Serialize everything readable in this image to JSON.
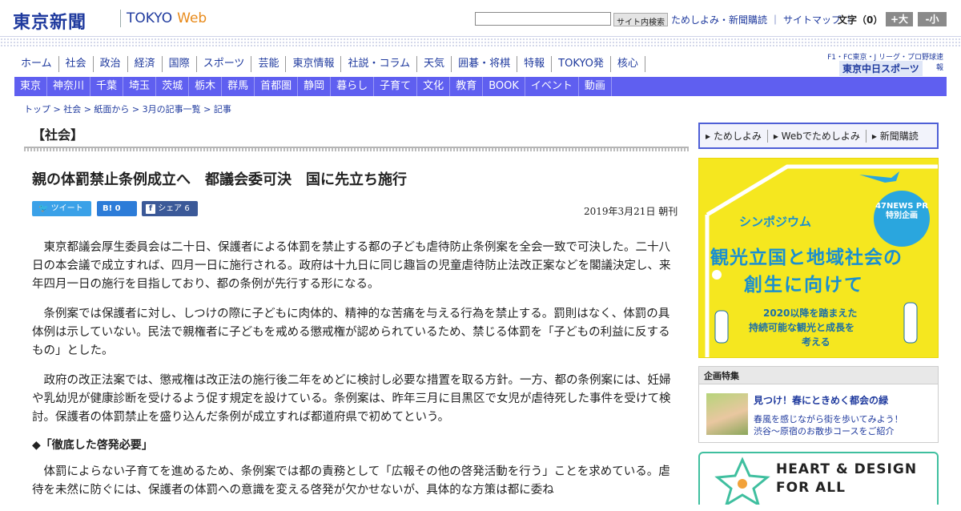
{
  "header": {
    "logo": "東京新聞",
    "logo_tokyo": "TOKYO",
    "logo_web": "Web",
    "search_button": "サイト内検索",
    "links": [
      "ためしよみ・新聞購読",
      "｜",
      "サイトマップ",
      "｜"
    ],
    "font_size_label": "文字（0）",
    "font_bigger": "+大",
    "font_smaller": "-小"
  },
  "nav_primary": [
    "ホーム",
    "社会",
    "政治",
    "経済",
    "国際",
    "スポーツ",
    "芸能",
    "東京情報",
    "社説・コラム",
    "天気",
    "囲碁・将棋",
    "特報",
    "TOKYO発",
    "核心"
  ],
  "chunichi": {
    "caption": "F1・FC東京・J リーグ・プロ野球速報",
    "brand": "東京中日スポーツ"
  },
  "nav_local": [
    "東京",
    "神奈川",
    "千葉",
    "埼玉",
    "茨城",
    "栃木",
    "群馬",
    "首都圏",
    "静岡",
    "暮らし",
    "子育て",
    "文化",
    "教育",
    "BOOK",
    "イベント",
    "動画"
  ],
  "breadcrumb": "トップ > 社会 > 紙面から > 3月の記事一覧 > 記事",
  "article": {
    "category": "【社会】",
    "headline": "親の体罰禁止条例成立へ　都議会委可決　国に先立ち施行",
    "share": {
      "tweet": "ツイート",
      "hatena": "B!  0",
      "facebook": "シェア 6"
    },
    "date": "2019年3月21日 朝刊",
    "p1": "東京都議会厚生委員会は二十日、保護者による体罰を禁止する都の子ども虐待防止条例案を全会一致で可決した。二十八日の本会議で成立すれば、四月一日に施行される。政府は十九日に同じ趣旨の児童虐待防止法改正案などを閣議決定し、来年四月一日の施行を目指しており、都の条例が先行する形になる。",
    "p2": "条例案では保護者に対し、しつけの際に子どもに肉体的、精神的な苦痛を与える行為を禁止する。罰則はなく、体罰の具体例は示していない。民法で親権者に子どもを戒める懲戒権が認められているため、禁じる体罰を「子どもの利益に反するもの」とした。",
    "p3": "政府の改正法案では、懲戒権は改正法の施行後二年をめどに検討し必要な措置を取る方針。一方、都の条例案には、妊婦や乳幼児が健康診断を受けるよう促す規定を設けている。条例案は、昨年三月に目黒区で女児が虐待死した事件を受けて検討。保護者の体罰禁止を盛り込んだ条例が成立すれば都道府県で初めてという。",
    "subhead": "◆「徹底した啓発必要」",
    "p4": "体罰によらない子育てを進めるため、条例案では都の責務として「広報その他の啓発活動を行う」ことを求めている。虐待を未然に防ぐには、保護者の体罰への意識を変える啓発が欠かせないが、具体的な方策は都に委ね"
  },
  "sidebar": {
    "promo_links": [
      "▸ ためしよみ",
      "▸ Webでためしよみ",
      "▸ 新聞購読"
    ],
    "symposium": {
      "badge": "47NEWS PR 特別企画",
      "title": "シンポジウム",
      "main1": "観光立国と地域社会の",
      "main2": "創生に向けて",
      "sub1": "2020以降を踏まえた",
      "sub2": "持続可能な観光と成長を",
      "sub3": "考える"
    },
    "feature": {
      "header": "企画特集",
      "title": "見つけ！春にときめく都会の緑",
      "desc1": "春風を感じながら街を歩いてみよう！",
      "desc2": "渋谷～原宿のお散歩コースをご紹介"
    },
    "heart": {
      "line1": "HEART & DESIGN",
      "line2": "FOR ALL"
    }
  }
}
